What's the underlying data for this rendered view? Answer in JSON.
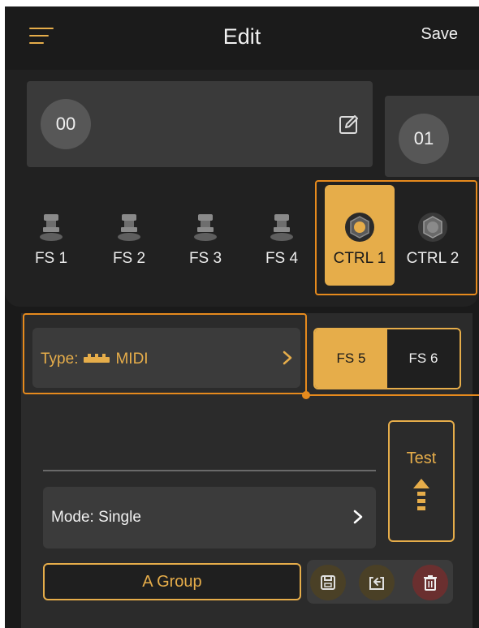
{
  "header": {
    "title": "Edit",
    "save_label": "Save",
    "menu_icon": "menu-icon"
  },
  "presets": [
    {
      "number": "00",
      "edit_icon": "edit-icon"
    },
    {
      "number": "01"
    }
  ],
  "switches": [
    {
      "label": "FS 1",
      "icon": "footswitch-icon",
      "active": false
    },
    {
      "label": "FS 2",
      "icon": "footswitch-icon",
      "active": false
    },
    {
      "label": "FS 3",
      "icon": "footswitch-icon",
      "active": false
    },
    {
      "label": "FS 4",
      "icon": "footswitch-icon",
      "active": false
    },
    {
      "label": "CTRL 1",
      "icon": "ctrl-knob-icon",
      "active": true
    },
    {
      "label": "CTRL 2",
      "icon": "ctrl-knob-icon",
      "active": false
    }
  ],
  "type": {
    "label": "Type:",
    "value": "MIDI",
    "icon": "midi-connector-icon"
  },
  "fs_toggle": {
    "options": [
      "FS 5",
      "FS 6"
    ],
    "selected": "FS 5"
  },
  "test": {
    "label": "Test",
    "icon": "arrow-up-icon"
  },
  "mode": {
    "label": "Mode: Single"
  },
  "group": {
    "label": "A Group"
  },
  "actions": [
    {
      "icon": "save-icon"
    },
    {
      "icon": "restore-icon"
    },
    {
      "icon": "trash-icon"
    }
  ],
  "colors": {
    "accent": "#e6ad4a",
    "highlight": "#e68a1d",
    "background": "#1a1a1a",
    "delete": "#6a2f2f"
  }
}
